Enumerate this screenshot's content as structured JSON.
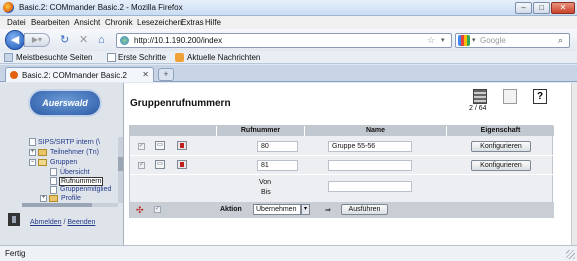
{
  "window": {
    "title": "Basic.2: COMmander Basic.2 - Mozilla Firefox"
  },
  "menu": [
    "Datei",
    "Bearbeiten",
    "Ansicht",
    "Chronik",
    "Lesezeichen",
    "Extras",
    "Hilfe"
  ],
  "nav": {
    "url": "http://10.1.190.200/index",
    "search_placeholder": "Google"
  },
  "bookmarks": [
    "Meistbesuchte Seiten",
    "Erste Schritte",
    "Aktuelle Nachrichten"
  ],
  "tab": {
    "label": "Basic.2: COMmander Basic.2",
    "new_tab": "+"
  },
  "sidebar": {
    "logo": "Auerswald",
    "tree": [
      "SIPS/SRTP intern (\\",
      "Teilnehmer (Tn)",
      "Gruppen",
      "Übersicht",
      "Rufnummern",
      "Gruppenmitglied",
      "Profile"
    ],
    "logout": "Abmelden",
    "separator": "/",
    "exit": "Beenden"
  },
  "main": {
    "title": "Gruppenrufnummern",
    "count": "2 / 64",
    "columns": {
      "number": "Rufnummer",
      "name": "Name",
      "property": "Eigenschaft"
    },
    "rows": [
      {
        "number": "80",
        "name": "Gruppe 55-56",
        "button": "Konfigurieren"
      },
      {
        "number": "81",
        "name": "",
        "button": "Konfigurieren"
      }
    ],
    "range": {
      "from": "Von",
      "to": "Bis"
    },
    "action": {
      "label": "Aktion",
      "value": "Übernehmen",
      "execute": "Ausführen"
    }
  },
  "status": "Fertig"
}
